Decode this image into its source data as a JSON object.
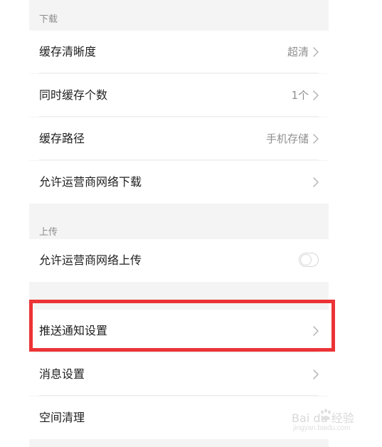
{
  "sections": {
    "download": {
      "label": "下载",
      "rows": [
        {
          "title": "缓存清晰度",
          "value": "超清"
        },
        {
          "title": "同时缓存个数",
          "value": "1个"
        },
        {
          "title": "缓存路径",
          "value": "手机存储"
        },
        {
          "title": "允许运营商网络下载",
          "value": ""
        }
      ]
    },
    "upload": {
      "label": "上传",
      "rows": [
        {
          "title": "允许运营商网络上传",
          "toggle": false
        }
      ]
    },
    "other": {
      "rows": [
        {
          "title": "推送通知设置"
        },
        {
          "title": "消息设置"
        },
        {
          "title": "空间清理"
        }
      ]
    }
  },
  "annotation": {
    "highlight_color": "#ec3336"
  },
  "watermark": {
    "text": "Bai du 经验",
    "subtext": "jingyan.baidu.com"
  },
  "colors": {
    "background": "#f4f4f4",
    "row_background": "#ffffff",
    "title_text": "#1f1f1f",
    "value_text": "#8f8f8f",
    "section_label": "#8d8d8d"
  },
  "icons": {
    "chevron": "chevron-right-icon",
    "toggle": "toggle-switch-off",
    "watermark_logo": "baidu-paw-icon"
  }
}
